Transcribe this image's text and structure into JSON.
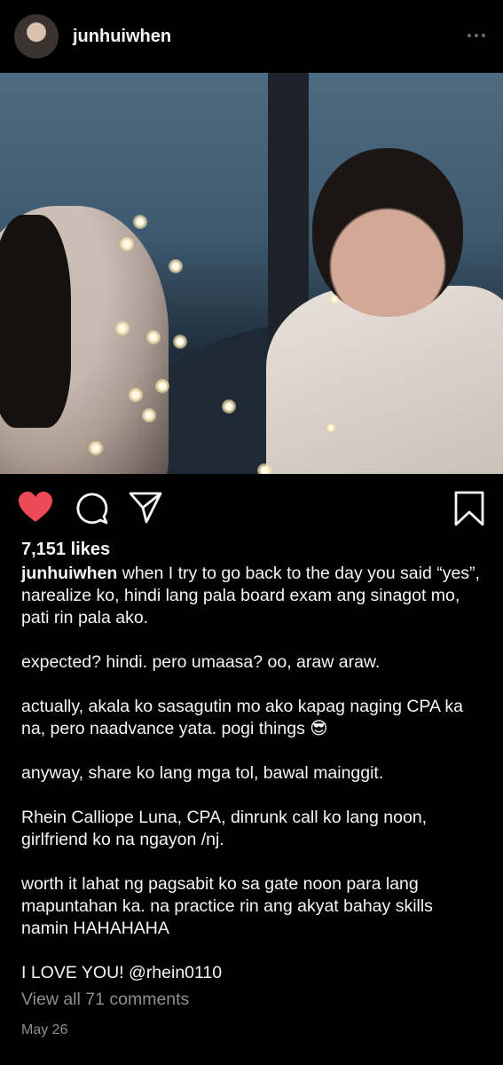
{
  "header": {
    "username": "junhuiwhen"
  },
  "post": {
    "likes": "7,151 likes",
    "caption": {
      "username": "junhuiwhen",
      "paragraphs": [
        "when I try to go back to the day you said “yes”, narealize ko, hindi lang pala board exam ang sinagot mo, pati rin pala ako.",
        "expected? hindi. pero umaasa? oo, araw araw.",
        "actually, akala ko sasagutin mo ako kapag naging CPA ka na, pero naadvance yata. pogi things 😎",
        "anyway, share ko lang mga tol, bawal mainggit.",
        "Rhein Calliope Luna, CPA, dinrunk call ko lang noon, girlfriend ko na ngayon /nj.",
        "worth it lahat ng pagsabit ko sa gate noon para lang mapuntahan ka. na practice rin ang akyat bahay skills namin HAHAHAHA",
        "I LOVE YOU! @rhein0110"
      ]
    },
    "view_comments": "View all 71 comments",
    "date": "May 26"
  },
  "icons": {
    "like": "heart-icon",
    "comment": "comment-icon",
    "share": "paper-plane-icon",
    "save": "bookmark-icon",
    "more": "more-dots-icon"
  },
  "colors": {
    "like_red": "#ed4956",
    "muted": "#8e8e8e",
    "background": "#000000"
  }
}
